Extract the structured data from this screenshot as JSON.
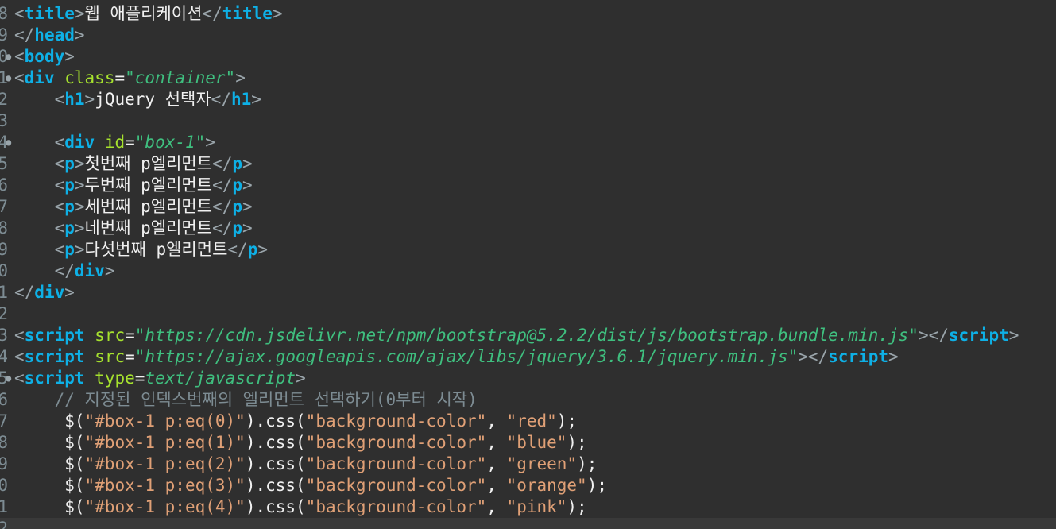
{
  "editor": {
    "lines": [
      {
        "num": "8",
        "fold": false,
        "indent": "",
        "tokens": [
          {
            "c": "bracket",
            "t": "<"
          },
          {
            "c": "tag",
            "t": "title"
          },
          {
            "c": "bracket",
            "t": ">"
          },
          {
            "c": "text",
            "t": "웹 애플리케이션"
          },
          {
            "c": "bracket",
            "t": "</"
          },
          {
            "c": "tag",
            "t": "title"
          },
          {
            "c": "bracket",
            "t": ">"
          }
        ]
      },
      {
        "num": "9",
        "fold": false,
        "indent": "",
        "tokens": [
          {
            "c": "bracket",
            "t": "</"
          },
          {
            "c": "tag",
            "t": "head"
          },
          {
            "c": "bracket",
            "t": ">"
          }
        ]
      },
      {
        "num": "0",
        "fold": true,
        "indent": "",
        "tokens": [
          {
            "c": "bracket",
            "t": "<"
          },
          {
            "c": "tag",
            "t": "body"
          },
          {
            "c": "bracket",
            "t": ">"
          }
        ]
      },
      {
        "num": "1",
        "fold": true,
        "indent": "",
        "tokens": [
          {
            "c": "bracket",
            "t": "<"
          },
          {
            "c": "tag",
            "t": "div"
          },
          {
            "c": "plain",
            "t": " "
          },
          {
            "c": "attr",
            "t": "class"
          },
          {
            "c": "plain",
            "t": "="
          },
          {
            "c": "attrval",
            "t": "\"container\""
          },
          {
            "c": "bracket",
            "t": ">"
          }
        ]
      },
      {
        "num": "2",
        "fold": false,
        "indent": "    ",
        "tokens": [
          {
            "c": "bracket",
            "t": "<"
          },
          {
            "c": "tag",
            "t": "h1"
          },
          {
            "c": "bracket",
            "t": ">"
          },
          {
            "c": "text",
            "t": "jQuery 선택자"
          },
          {
            "c": "bracket",
            "t": "</"
          },
          {
            "c": "tag",
            "t": "h1"
          },
          {
            "c": "bracket",
            "t": ">"
          }
        ]
      },
      {
        "num": "3",
        "fold": false,
        "indent": "",
        "tokens": []
      },
      {
        "num": "4",
        "fold": true,
        "indent": "    ",
        "tokens": [
          {
            "c": "bracket",
            "t": "<"
          },
          {
            "c": "tag",
            "t": "div"
          },
          {
            "c": "plain",
            "t": " "
          },
          {
            "c": "attr",
            "t": "id"
          },
          {
            "c": "plain",
            "t": "="
          },
          {
            "c": "attrval",
            "t": "\"box-1\""
          },
          {
            "c": "bracket",
            "t": ">"
          }
        ]
      },
      {
        "num": "5",
        "fold": false,
        "indent": "    ",
        "tokens": [
          {
            "c": "bracket",
            "t": "<"
          },
          {
            "c": "tag",
            "t": "p"
          },
          {
            "c": "bracket",
            "t": ">"
          },
          {
            "c": "text",
            "t": "첫번째 p엘리먼트"
          },
          {
            "c": "bracket",
            "t": "</"
          },
          {
            "c": "tag",
            "t": "p"
          },
          {
            "c": "bracket",
            "t": ">"
          }
        ]
      },
      {
        "num": "6",
        "fold": false,
        "indent": "    ",
        "tokens": [
          {
            "c": "bracket",
            "t": "<"
          },
          {
            "c": "tag",
            "t": "p"
          },
          {
            "c": "bracket",
            "t": ">"
          },
          {
            "c": "text",
            "t": "두번째 p엘리먼트"
          },
          {
            "c": "bracket",
            "t": "</"
          },
          {
            "c": "tag",
            "t": "p"
          },
          {
            "c": "bracket",
            "t": ">"
          }
        ]
      },
      {
        "num": "7",
        "fold": false,
        "indent": "    ",
        "tokens": [
          {
            "c": "bracket",
            "t": "<"
          },
          {
            "c": "tag",
            "t": "p"
          },
          {
            "c": "bracket",
            "t": ">"
          },
          {
            "c": "text",
            "t": "세번째 p엘리먼트"
          },
          {
            "c": "bracket",
            "t": "</"
          },
          {
            "c": "tag",
            "t": "p"
          },
          {
            "c": "bracket",
            "t": ">"
          }
        ]
      },
      {
        "num": "8",
        "fold": false,
        "indent": "    ",
        "tokens": [
          {
            "c": "bracket",
            "t": "<"
          },
          {
            "c": "tag",
            "t": "p"
          },
          {
            "c": "bracket",
            "t": ">"
          },
          {
            "c": "text",
            "t": "네번째 p엘리먼트"
          },
          {
            "c": "bracket",
            "t": "</"
          },
          {
            "c": "tag",
            "t": "p"
          },
          {
            "c": "bracket",
            "t": ">"
          }
        ]
      },
      {
        "num": "9",
        "fold": false,
        "indent": "    ",
        "tokens": [
          {
            "c": "bracket",
            "t": "<"
          },
          {
            "c": "tag",
            "t": "p"
          },
          {
            "c": "bracket",
            "t": ">"
          },
          {
            "c": "text",
            "t": "다섯번째 p엘리먼트"
          },
          {
            "c": "bracket",
            "t": "</"
          },
          {
            "c": "tag",
            "t": "p"
          },
          {
            "c": "bracket",
            "t": ">"
          }
        ]
      },
      {
        "num": "0",
        "fold": false,
        "indent": "    ",
        "tokens": [
          {
            "c": "bracket",
            "t": "</"
          },
          {
            "c": "tag",
            "t": "div"
          },
          {
            "c": "bracket",
            "t": ">"
          }
        ]
      },
      {
        "num": "1",
        "fold": false,
        "indent": "",
        "tokens": [
          {
            "c": "bracket",
            "t": "</"
          },
          {
            "c": "tag",
            "t": "div"
          },
          {
            "c": "bracket",
            "t": ">"
          }
        ]
      },
      {
        "num": "2",
        "fold": false,
        "indent": "",
        "tokens": []
      },
      {
        "num": "3",
        "fold": false,
        "indent": "",
        "tokens": [
          {
            "c": "bracket",
            "t": "<"
          },
          {
            "c": "tag",
            "t": "script"
          },
          {
            "c": "plain",
            "t": " "
          },
          {
            "c": "attr",
            "t": "src"
          },
          {
            "c": "plain",
            "t": "="
          },
          {
            "c": "attrval",
            "t": "\"https://cdn.jsdelivr.net/npm/bootstrap@5.2.2/dist/js/bootstrap.bundle.min.js\""
          },
          {
            "c": "bracket",
            "t": "></"
          },
          {
            "c": "tag",
            "t": "script"
          },
          {
            "c": "bracket",
            "t": ">"
          }
        ]
      },
      {
        "num": "4",
        "fold": false,
        "indent": "",
        "tokens": [
          {
            "c": "bracket",
            "t": "<"
          },
          {
            "c": "tag",
            "t": "script"
          },
          {
            "c": "plain",
            "t": " "
          },
          {
            "c": "attr",
            "t": "src"
          },
          {
            "c": "plain",
            "t": "="
          },
          {
            "c": "attrval",
            "t": "\"https://ajax.googleapis.com/ajax/libs/jquery/3.6.1/jquery.min.js\""
          },
          {
            "c": "bracket",
            "t": "></"
          },
          {
            "c": "tag",
            "t": "script"
          },
          {
            "c": "bracket",
            "t": ">"
          }
        ]
      },
      {
        "num": "5",
        "fold": true,
        "indent": "",
        "tokens": [
          {
            "c": "bracket",
            "t": "<"
          },
          {
            "c": "tag",
            "t": "script"
          },
          {
            "c": "plain",
            "t": " "
          },
          {
            "c": "attr",
            "t": "type"
          },
          {
            "c": "plain",
            "t": "="
          },
          {
            "c": "attrval",
            "t": "text/javascript"
          },
          {
            "c": "bracket",
            "t": ">"
          }
        ]
      },
      {
        "num": "6",
        "fold": false,
        "indent": "    ",
        "tokens": [
          {
            "c": "comment",
            "t": "// 지정된 인덱스번째의 엘리먼트 선택하기(0부터 시작)"
          }
        ]
      },
      {
        "num": "7",
        "fold": false,
        "indent": "     ",
        "tokens": [
          {
            "c": "plain",
            "t": "$("
          },
          {
            "c": "string",
            "t": "\"#box-1 p:eq(0)\""
          },
          {
            "c": "plain",
            "t": ").css("
          },
          {
            "c": "string",
            "t": "\"background-color\""
          },
          {
            "c": "plain",
            "t": ", "
          },
          {
            "c": "string",
            "t": "\"red\""
          },
          {
            "c": "plain",
            "t": ");"
          }
        ]
      },
      {
        "num": "8",
        "fold": false,
        "indent": "     ",
        "tokens": [
          {
            "c": "plain",
            "t": "$("
          },
          {
            "c": "string",
            "t": "\"#box-1 p:eq(1)\""
          },
          {
            "c": "plain",
            "t": ").css("
          },
          {
            "c": "string",
            "t": "\"background-color\""
          },
          {
            "c": "plain",
            "t": ", "
          },
          {
            "c": "string",
            "t": "\"blue\""
          },
          {
            "c": "plain",
            "t": ");"
          }
        ]
      },
      {
        "num": "9",
        "fold": false,
        "indent": "     ",
        "tokens": [
          {
            "c": "plain",
            "t": "$("
          },
          {
            "c": "string",
            "t": "\"#box-1 p:eq(2)\""
          },
          {
            "c": "plain",
            "t": ").css("
          },
          {
            "c": "string",
            "t": "\"background-color\""
          },
          {
            "c": "plain",
            "t": ", "
          },
          {
            "c": "string",
            "t": "\"green\""
          },
          {
            "c": "plain",
            "t": ");"
          }
        ]
      },
      {
        "num": "0",
        "fold": false,
        "indent": "     ",
        "tokens": [
          {
            "c": "plain",
            "t": "$("
          },
          {
            "c": "string",
            "t": "\"#box-1 p:eq(3)\""
          },
          {
            "c": "plain",
            "t": ").css("
          },
          {
            "c": "string",
            "t": "\"background-color\""
          },
          {
            "c": "plain",
            "t": ", "
          },
          {
            "c": "string",
            "t": "\"orange\""
          },
          {
            "c": "plain",
            "t": ");"
          }
        ]
      },
      {
        "num": "1",
        "fold": false,
        "indent": "     ",
        "tokens": [
          {
            "c": "plain",
            "t": "$("
          },
          {
            "c": "string",
            "t": "\"#box-1 p:eq(4)\""
          },
          {
            "c": "plain",
            "t": ").css("
          },
          {
            "c": "string",
            "t": "\"background-color\""
          },
          {
            "c": "plain",
            "t": ", "
          },
          {
            "c": "string",
            "t": "\"pink\""
          },
          {
            "c": "plain",
            "t": ");"
          }
        ]
      },
      {
        "num": "2",
        "fold": false,
        "indent": "",
        "tokens": [],
        "current": true
      }
    ]
  },
  "colors": {
    "background": "#2f2f2f",
    "current_line": "#393939",
    "tag": "#0eb0e6",
    "attribute": "#a6e22e",
    "attribute_value": "#3fbf7f",
    "string": "#e0a076",
    "comment": "#7d8c93"
  },
  "icons": {
    "fold_marker": "fold-toggle-icon"
  }
}
